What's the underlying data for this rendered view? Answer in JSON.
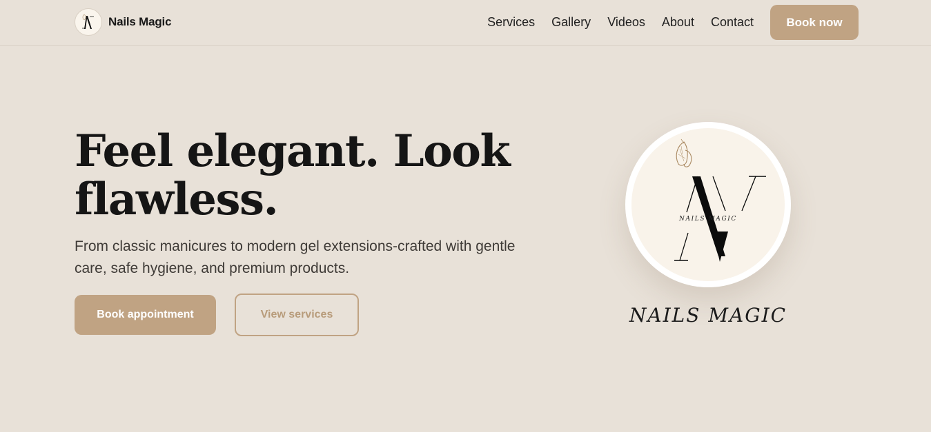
{
  "brand": {
    "name": "Nails Magic"
  },
  "nav": {
    "items": [
      {
        "label": "Services"
      },
      {
        "label": "Gallery"
      },
      {
        "label": "Videos"
      },
      {
        "label": "About"
      },
      {
        "label": "Contact"
      }
    ],
    "cta_label": "Book now"
  },
  "hero": {
    "title": "Feel elegant. Look flawless.",
    "subtitle": "From classic manicures to modern gel extensions-crafted with gentle care, safe hygiene, and premium products.",
    "primary_button": "Book appointment",
    "secondary_button": "View services"
  },
  "emblem": {
    "logo_text": "NAILS MAGIC",
    "caption": "NAILS MAGIC"
  },
  "colors": {
    "background": "#e8e1d8",
    "accent": "#c0a383",
    "text": "#151515"
  },
  "icons": {
    "logo": "nails-magic-monogram-icon",
    "butterfly": "butterfly-icon"
  }
}
